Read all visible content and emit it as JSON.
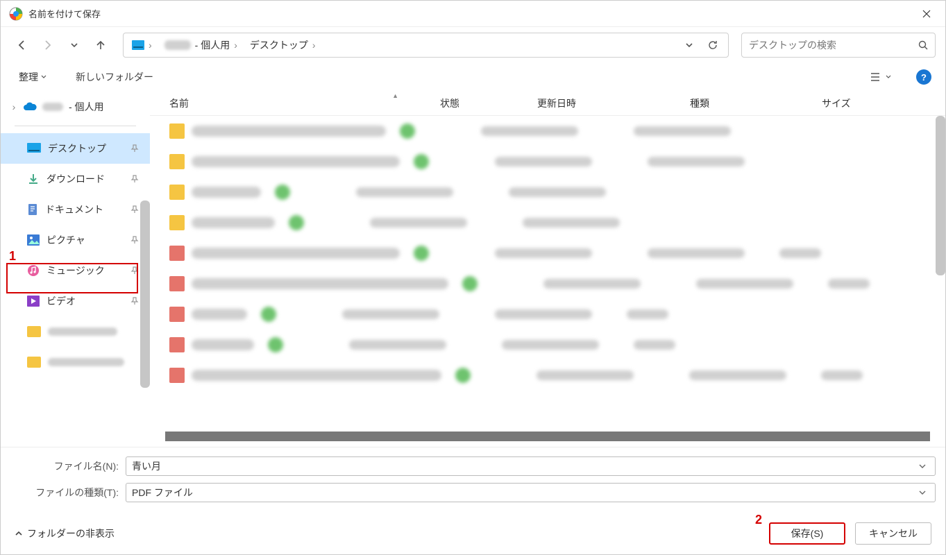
{
  "title": "名前を付けて保存",
  "breadcrumb": {
    "redacted": "　　　",
    "personal_suffix": " - 個人用",
    "desktop": "デスクトップ"
  },
  "search": {
    "placeholder": "デスクトップの検索"
  },
  "toolbar": {
    "organize": "整理",
    "new_folder": "新しいフォルダー"
  },
  "tree": {
    "personal": " - 個人用"
  },
  "quick_access": [
    {
      "name": "デスクトップ",
      "icon": "desktop",
      "selected": true
    },
    {
      "name": "ダウンロード",
      "icon": "download"
    },
    {
      "name": "ドキュメント",
      "icon": "document"
    },
    {
      "name": "ピクチャ",
      "icon": "picture"
    },
    {
      "name": "ミュージック",
      "icon": "music"
    },
    {
      "name": "ビデオ",
      "icon": "video"
    }
  ],
  "columns": {
    "name": "名前",
    "state": "状態",
    "date": "更新日時",
    "type": "種類",
    "size": "サイズ"
  },
  "form": {
    "filename_label": "ファイル名(N):",
    "filename_value": "青い月",
    "filetype_label": "ファイルの種類(T):",
    "filetype_value": "PDF ファイル"
  },
  "buttons": {
    "hide_folders": "フォルダーの非表示",
    "save": "保存(S)",
    "cancel": "キャンセル"
  },
  "markers": {
    "one": "1",
    "two": "2"
  }
}
